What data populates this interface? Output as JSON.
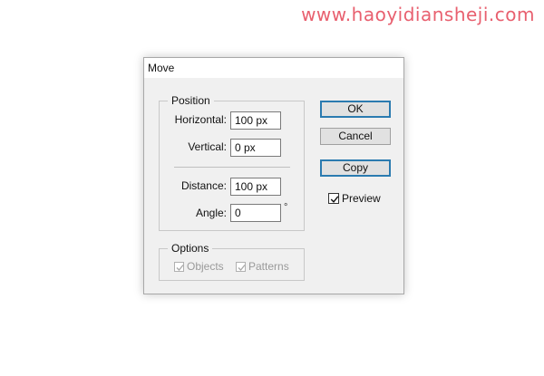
{
  "watermark": "www.haoyidiansheji.com",
  "dialog": {
    "title": "Move",
    "position_group": {
      "legend": "Position",
      "horizontal": {
        "label": "Horizontal:",
        "value": "100 px"
      },
      "vertical": {
        "label": "Vertical:",
        "value": "0 px"
      },
      "distance": {
        "label": "Distance:",
        "value": "100 px"
      },
      "angle": {
        "label": "Angle:",
        "value": "0",
        "unit": "°"
      }
    },
    "options_group": {
      "legend": "Options",
      "objects": {
        "label": "Objects",
        "checked": true,
        "enabled": false
      },
      "patterns": {
        "label": "Patterns",
        "checked": true,
        "enabled": false
      }
    },
    "buttons": {
      "ok": "OK",
      "cancel": "Cancel",
      "copy": "Copy"
    },
    "preview": {
      "label": "Preview",
      "checked": true
    }
  },
  "colors": {
    "watermark": "#e8606f",
    "focus_border": "#2b7bb0",
    "dialog_bg": "#f0f0f0"
  }
}
